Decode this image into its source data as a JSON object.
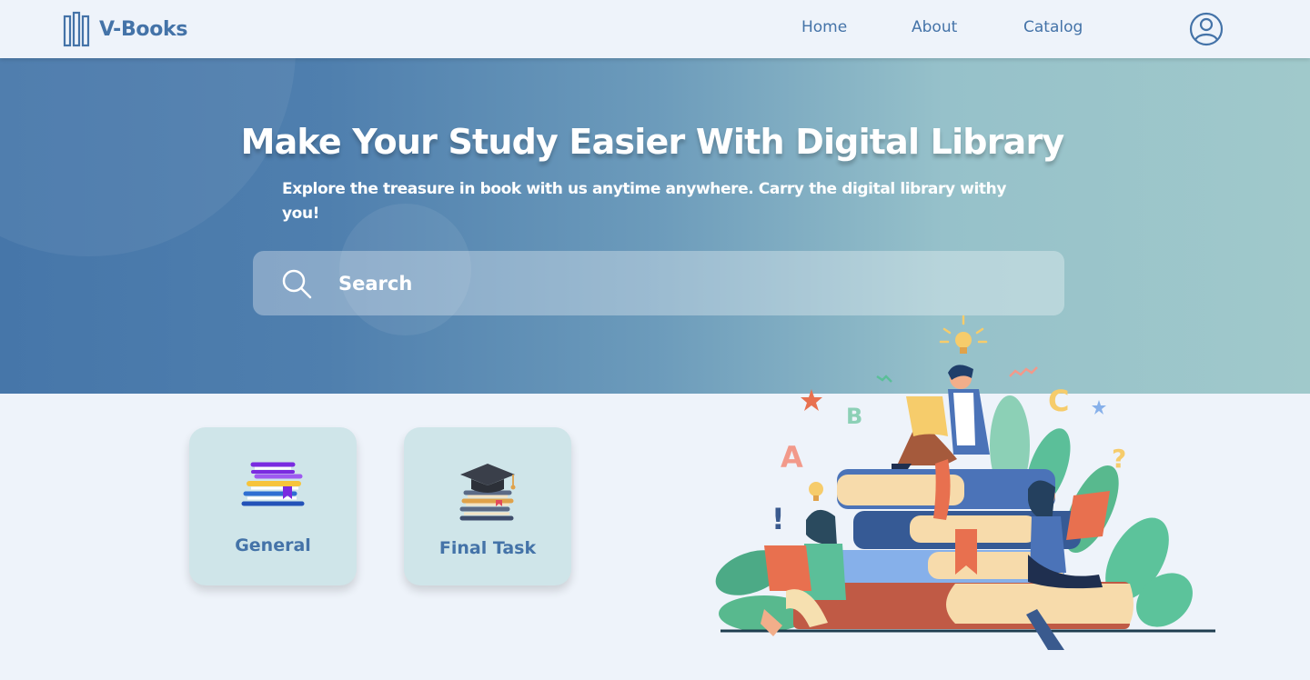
{
  "header": {
    "logo_text": "V-Books",
    "nav": [
      "Home",
      "About",
      "Catalog"
    ]
  },
  "hero": {
    "title": "Make Your Study Easier With Digital Library",
    "subtitle": "Explore the treasure in book with us anytime anywhere. Carry the digital library withy you!",
    "search_placeholder": "Search"
  },
  "categories": [
    {
      "label": "General",
      "icon": "stacked-books-icon"
    },
    {
      "label": "Final Task",
      "icon": "graduation-cap-books-icon"
    }
  ],
  "colors": {
    "brand": "#4473a8",
    "background": "#eef3fa",
    "card_bg": "#cfe5e9",
    "hero_start": "#4676a9",
    "hero_end": "#a0c9cb"
  }
}
